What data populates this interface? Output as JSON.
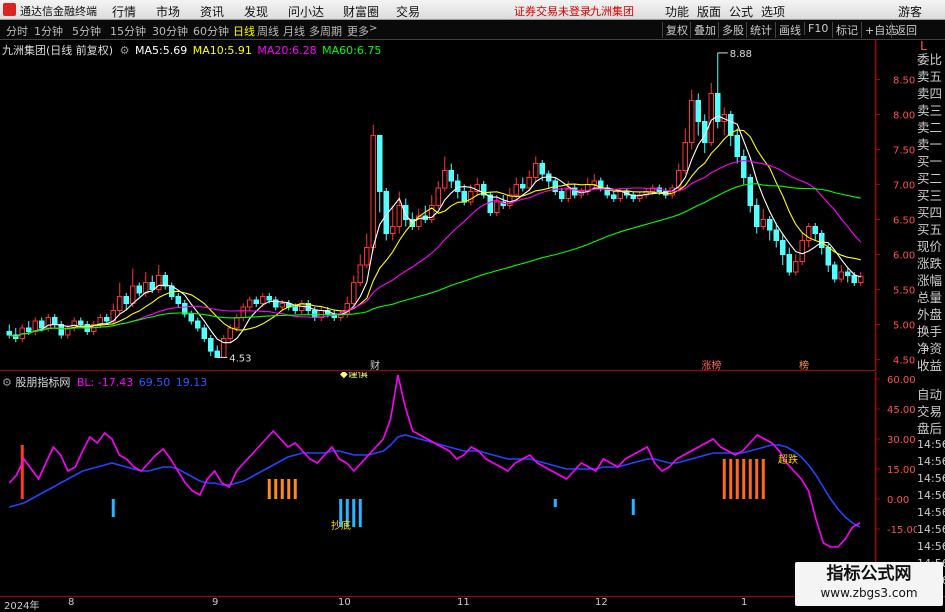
{
  "menubar": {
    "app_title": "通达信金融终端",
    "items": [
      "行情",
      "市场",
      "资讯",
      "发现",
      "问小达",
      "财富圈",
      "交易"
    ],
    "warning": "证券交易未登录",
    "stock_name": "九洲集团",
    "right_items": [
      "功能",
      "版面",
      "公式",
      "选项"
    ],
    "guest": "游客"
  },
  "timebar": {
    "periods": [
      "分时",
      "1分钟",
      "5分钟",
      "15分钟",
      "30分钟",
      "60分钟",
      "日线",
      "周线",
      "月线",
      "多周期",
      "更多"
    ],
    "active_period": "日线",
    "tools": [
      "复权",
      "叠加",
      "多股",
      "统计",
      "画线",
      "F10",
      "标记",
      "+自选",
      "返回"
    ]
  },
  "main_chart": {
    "title": "九洲集团(日线 前复权)",
    "ma": [
      {
        "label": "MA5:",
        "value": "5.69",
        "color": "#ffffff"
      },
      {
        "label": "MA10:",
        "value": "5.91",
        "color": "#ffff00"
      },
      {
        "label": "MA20:",
        "value": "6.28",
        "color": "#ff00ff"
      },
      {
        "label": "MA60:",
        "value": "6.75",
        "color": "#00ff00"
      }
    ],
    "high_label": "8.88",
    "low_label": "4.53",
    "event_labels": [
      "财",
      "涨榜",
      "榜"
    ]
  },
  "sub_chart": {
    "title": "股朋指标网",
    "legend_bl": "BL: -17.43",
    "legend_x": "69.50",
    "legend_y": "19.13",
    "sig1": "谨慎",
    "sig2": "超跌",
    "sig3": "抄底"
  },
  "price_axis": [
    "8.50",
    "8.00",
    "7.50",
    "7.00",
    "6.50",
    "6.00",
    "5.50",
    "5.00",
    "4.50"
  ],
  "ind_axis": [
    "60.00",
    "45.00",
    "30.00",
    "15.00",
    "0.00",
    "-15.00"
  ],
  "date_axis": [
    "2024年",
    "8",
    "9",
    "10",
    "11",
    "12",
    "1"
  ],
  "right_panel": {
    "top": "L",
    "labels": [
      "委比",
      "卖五",
      "卖四",
      "卖三",
      "卖二",
      "卖一",
      "买一",
      "买二",
      "买三",
      "买四",
      "买五",
      "现价",
      "涨跌",
      "涨幅",
      "总量",
      "外盘",
      "换手",
      "净资",
      "收益"
    ],
    "labels2": [
      "自动",
      "交易",
      "盘后"
    ],
    "times": [
      "14:56",
      "14:56",
      "14:56",
      "14:56",
      "14:56",
      "14:56",
      "14:56",
      "14:56",
      "14:56"
    ]
  },
  "watermark": {
    "line1": "指标公式网",
    "line2": "www.zbgs3.com"
  },
  "chart_data": {
    "type": "candlestick",
    "candles": [
      [
        4.9,
        4.85,
        5.0,
        4.8
      ],
      [
        4.85,
        4.8,
        4.95,
        4.75
      ],
      [
        4.8,
        4.95,
        5.0,
        4.75
      ],
      [
        4.95,
        4.9,
        5.05,
        4.85
      ],
      [
        4.9,
        5.05,
        5.1,
        4.85
      ],
      [
        5.05,
        4.95,
        5.1,
        4.9
      ],
      [
        4.95,
        5.1,
        5.15,
        4.9
      ],
      [
        5.1,
        5.0,
        5.15,
        4.95
      ],
      [
        5.0,
        4.85,
        5.05,
        4.8
      ],
      [
        4.85,
        4.95,
        5.0,
        4.8
      ],
      [
        4.95,
        5.05,
        5.1,
        4.9
      ],
      [
        5.05,
        5.0,
        5.1,
        4.95
      ],
      [
        5.0,
        4.9,
        5.05,
        4.85
      ],
      [
        4.9,
        5.0,
        5.05,
        4.85
      ],
      [
        5.0,
        5.1,
        5.15,
        4.95
      ],
      [
        5.1,
        5.05,
        5.15,
        5.0
      ],
      [
        5.05,
        5.2,
        5.3,
        5.0
      ],
      [
        5.2,
        5.4,
        5.6,
        5.15
      ],
      [
        5.4,
        5.3,
        5.45,
        5.2
      ],
      [
        5.3,
        5.55,
        5.8,
        5.25
      ],
      [
        5.55,
        5.45,
        5.6,
        5.4
      ],
      [
        5.45,
        5.6,
        5.75,
        5.4
      ],
      [
        5.6,
        5.5,
        5.7,
        5.45
      ],
      [
        5.5,
        5.7,
        5.85,
        5.45
      ],
      [
        5.7,
        5.55,
        5.75,
        5.5
      ],
      [
        5.55,
        5.4,
        5.6,
        5.35
      ],
      [
        5.4,
        5.3,
        5.45,
        5.25
      ],
      [
        5.3,
        5.15,
        5.35,
        5.1
      ],
      [
        5.15,
        5.05,
        5.2,
        5.0
      ],
      [
        5.05,
        4.95,
        5.1,
        4.9
      ],
      [
        4.95,
        4.8,
        5.0,
        4.75
      ],
      [
        4.8,
        4.62,
        4.85,
        4.55
      ],
      [
        4.62,
        4.53,
        4.7,
        4.53
      ],
      [
        4.53,
        4.8,
        4.85,
        4.53
      ],
      [
        4.8,
        4.95,
        5.0,
        4.75
      ],
      [
        4.95,
        5.1,
        5.15,
        4.9
      ],
      [
        5.1,
        5.25,
        5.3,
        5.05
      ],
      [
        5.25,
        5.35,
        5.4,
        5.2
      ],
      [
        5.35,
        5.3,
        5.4,
        5.25
      ],
      [
        5.3,
        5.4,
        5.45,
        5.25
      ],
      [
        5.4,
        5.35,
        5.45,
        5.3
      ],
      [
        5.35,
        5.25,
        5.4,
        5.2
      ],
      [
        5.25,
        5.3,
        5.35,
        5.2
      ],
      [
        5.3,
        5.25,
        5.35,
        5.2
      ],
      [
        5.25,
        5.2,
        5.3,
        5.15
      ],
      [
        5.2,
        5.3,
        5.35,
        5.15
      ],
      [
        5.3,
        5.2,
        5.35,
        5.15
      ],
      [
        5.2,
        5.1,
        5.25,
        5.05
      ],
      [
        5.1,
        5.2,
        5.25,
        5.05
      ],
      [
        5.2,
        5.15,
        5.25,
        5.1
      ],
      [
        5.15,
        5.1,
        5.2,
        5.05
      ],
      [
        5.1,
        5.15,
        5.2,
        5.05
      ],
      [
        5.15,
        5.3,
        5.4,
        5.1
      ],
      [
        5.3,
        5.6,
        5.7,
        5.25
      ],
      [
        5.6,
        5.85,
        6.0,
        5.55
      ],
      [
        5.85,
        6.1,
        6.3,
        5.8
      ],
      [
        6.1,
        7.7,
        7.85,
        6.05
      ],
      [
        7.7,
        6.9,
        7.7,
        6.6
      ],
      [
        6.9,
        6.3,
        6.95,
        6.2
      ],
      [
        6.3,
        6.4,
        6.7,
        6.2
      ],
      [
        6.4,
        6.7,
        6.9,
        6.3
      ],
      [
        6.7,
        6.5,
        6.8,
        6.4
      ],
      [
        6.5,
        6.4,
        6.6,
        6.35
      ],
      [
        6.4,
        6.55,
        6.65,
        6.35
      ],
      [
        6.55,
        6.5,
        6.7,
        6.45
      ],
      [
        6.5,
        6.7,
        6.85,
        6.45
      ],
      [
        6.7,
        6.95,
        7.05,
        6.65
      ],
      [
        6.95,
        7.2,
        7.4,
        6.9
      ],
      [
        7.2,
        7.05,
        7.3,
        6.95
      ],
      [
        7.05,
        6.9,
        7.15,
        6.8
      ],
      [
        6.9,
        6.75,
        7.0,
        6.7
      ],
      [
        6.75,
        6.9,
        7.0,
        6.7
      ],
      [
        6.9,
        7.0,
        7.1,
        6.85
      ],
      [
        7.0,
        6.85,
        7.05,
        6.8
      ],
      [
        6.85,
        6.6,
        6.9,
        6.55
      ],
      [
        6.6,
        6.75,
        6.85,
        6.55
      ],
      [
        6.75,
        6.7,
        6.85,
        6.65
      ],
      [
        6.7,
        6.85,
        6.95,
        6.65
      ],
      [
        6.85,
        7.0,
        7.1,
        6.8
      ],
      [
        7.0,
        6.95,
        7.1,
        6.9
      ],
      [
        6.95,
        7.1,
        7.2,
        6.9
      ],
      [
        7.1,
        7.3,
        7.4,
        7.05
      ],
      [
        7.3,
        7.15,
        7.35,
        7.05
      ],
      [
        7.15,
        7.05,
        7.2,
        6.95
      ],
      [
        7.05,
        6.9,
        7.1,
        6.85
      ],
      [
        6.9,
        6.8,
        6.95,
        6.75
      ],
      [
        6.8,
        6.95,
        7.05,
        6.75
      ],
      [
        6.95,
        6.85,
        7.0,
        6.8
      ],
      [
        6.85,
        6.9,
        6.95,
        6.8
      ],
      [
        6.9,
        7.0,
        7.1,
        6.85
      ],
      [
        7.0,
        7.05,
        7.15,
        6.95
      ],
      [
        7.05,
        6.95,
        7.1,
        6.9
      ],
      [
        6.95,
        6.85,
        7.0,
        6.8
      ],
      [
        6.85,
        6.8,
        6.9,
        6.75
      ],
      [
        6.8,
        6.9,
        6.95,
        6.75
      ],
      [
        6.9,
        6.85,
        6.95,
        6.8
      ],
      [
        6.85,
        6.8,
        6.9,
        6.75
      ],
      [
        6.8,
        6.85,
        6.9,
        6.75
      ],
      [
        6.85,
        6.9,
        6.95,
        6.8
      ],
      [
        6.9,
        6.95,
        7.0,
        6.85
      ],
      [
        6.95,
        6.9,
        7.0,
        6.85
      ],
      [
        6.9,
        6.85,
        6.95,
        6.8
      ],
      [
        6.85,
        6.95,
        7.0,
        6.8
      ],
      [
        6.95,
        7.2,
        7.3,
        6.9
      ],
      [
        7.2,
        7.6,
        7.8,
        7.15
      ],
      [
        7.6,
        8.2,
        8.35,
        7.5
      ],
      [
        8.2,
        7.9,
        8.3,
        7.7
      ],
      [
        7.9,
        7.6,
        8.0,
        7.45
      ],
      [
        7.6,
        8.3,
        8.45,
        7.55
      ],
      [
        8.3,
        7.9,
        8.88,
        7.8
      ],
      [
        7.9,
        8.0,
        8.1,
        7.7
      ],
      [
        8.0,
        7.7,
        8.05,
        7.55
      ],
      [
        7.7,
        7.4,
        7.8,
        7.3
      ],
      [
        7.4,
        7.1,
        7.5,
        7.0
      ],
      [
        7.1,
        6.7,
        7.15,
        6.6
      ],
      [
        6.7,
        6.4,
        6.8,
        6.3
      ],
      [
        6.4,
        6.5,
        6.65,
        6.35
      ],
      [
        6.5,
        6.35,
        6.55,
        6.2
      ],
      [
        6.35,
        6.2,
        6.45,
        6.1
      ],
      [
        6.2,
        6.0,
        6.3,
        5.85
      ],
      [
        6.0,
        5.75,
        6.1,
        5.7
      ],
      [
        5.75,
        5.9,
        6.0,
        5.7
      ],
      [
        5.9,
        6.2,
        6.3,
        5.85
      ],
      [
        6.2,
        6.4,
        6.45,
        6.1
      ],
      [
        6.4,
        6.3,
        6.45,
        6.2
      ],
      [
        6.3,
        6.1,
        6.35,
        6.0
      ],
      [
        6.1,
        5.85,
        6.15,
        5.75
      ],
      [
        5.85,
        5.65,
        5.9,
        5.6
      ],
      [
        5.65,
        5.75,
        5.85,
        5.6
      ],
      [
        5.75,
        5.7,
        5.8,
        5.6
      ],
      [
        5.7,
        5.6,
        5.75,
        5.55
      ],
      [
        5.6,
        5.69,
        5.75,
        5.55
      ]
    ],
    "indicator": {
      "purple": [
        8,
        12,
        20,
        15,
        10,
        18,
        26,
        22,
        14,
        16,
        24,
        31,
        28,
        33,
        30,
        22,
        20,
        16,
        14,
        18,
        22,
        25,
        20,
        14,
        8,
        4,
        2,
        10,
        14,
        8,
        6,
        14,
        18,
        22,
        26,
        30,
        34,
        30,
        26,
        28,
        24,
        20,
        18,
        22,
        26,
        20,
        18,
        14,
        18,
        22,
        26,
        30,
        40,
        62,
        46,
        34,
        32,
        30,
        28,
        26,
        24,
        20,
        22,
        26,
        24,
        20,
        18,
        16,
        14,
        18,
        20,
        22,
        18,
        16,
        14,
        12,
        10,
        14,
        18,
        16,
        14,
        20,
        18,
        16,
        20,
        22,
        24,
        26,
        18,
        14,
        16,
        20,
        22,
        24,
        26,
        28,
        30,
        26,
        24,
        22,
        24,
        28,
        32,
        30,
        28,
        24,
        18,
        14,
        10,
        4,
        -10,
        -22,
        -24,
        -24,
        -20,
        -14,
        -12
      ],
      "blue": [
        -4,
        -3,
        -2,
        0,
        2,
        4,
        6,
        8,
        10,
        12,
        14,
        15,
        16,
        17,
        18,
        17,
        16,
        15,
        14,
        14,
        15,
        16,
        16,
        15,
        13,
        11,
        9,
        8,
        8,
        7,
        7,
        8,
        9,
        11,
        13,
        15,
        17,
        19,
        21,
        22,
        23,
        23,
        23,
        23,
        24,
        24,
        23,
        22,
        22,
        22,
        23,
        24,
        27,
        31,
        32,
        31,
        30,
        29,
        28,
        27,
        26,
        25,
        24,
        24,
        24,
        23,
        22,
        21,
        20,
        20,
        20,
        20,
        19,
        18,
        17,
        16,
        15,
        15,
        15,
        15,
        15,
        16,
        16,
        16,
        17,
        18,
        19,
        20,
        20,
        19,
        18,
        18,
        19,
        20,
        21,
        22,
        23,
        23,
        23,
        23,
        23,
        24,
        25,
        26,
        27,
        27,
        26,
        24,
        21,
        17,
        12,
        6,
        0,
        -5,
        -9,
        -12,
        -14
      ]
    }
  }
}
